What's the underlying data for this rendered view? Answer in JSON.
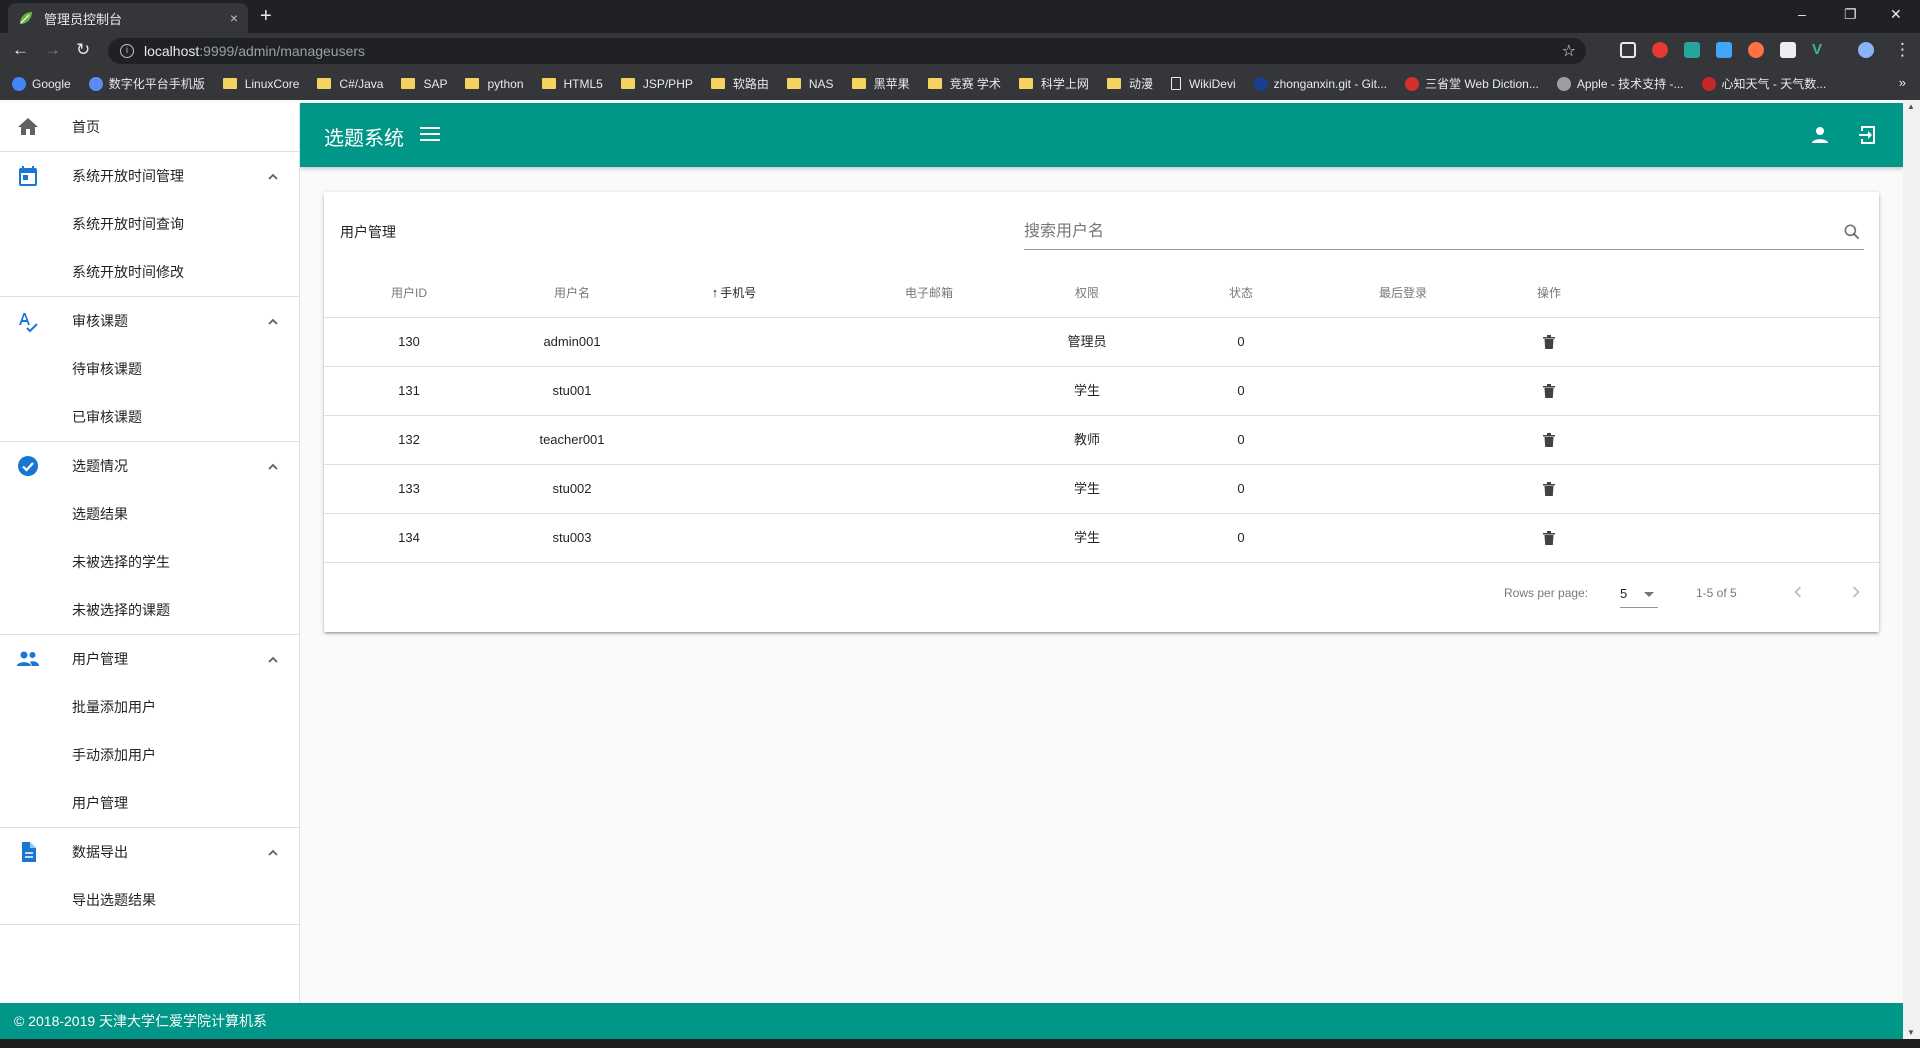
{
  "browser": {
    "tab_title": "管理员控制台",
    "tab_close": "×",
    "new_tab": "+",
    "url_host": "localhost",
    "url_path": ":9999/admin/manageusers",
    "bookmarks": [
      {
        "label": "Google",
        "kind": "dot",
        "color": "#4285f4"
      },
      {
        "label": "数字化平台手机版",
        "kind": "dot",
        "color": "#5b8def"
      },
      {
        "label": "LinuxCore",
        "kind": "folder"
      },
      {
        "label": "C#/Java",
        "kind": "folder"
      },
      {
        "label": "SAP",
        "kind": "folder"
      },
      {
        "label": "python",
        "kind": "folder"
      },
      {
        "label": "HTML5",
        "kind": "folder"
      },
      {
        "label": "JSP/PHP",
        "kind": "folder"
      },
      {
        "label": "软路由",
        "kind": "folder"
      },
      {
        "label": "NAS",
        "kind": "folder"
      },
      {
        "label": "黑苹果",
        "kind": "folder"
      },
      {
        "label": "竞赛 学术",
        "kind": "folder"
      },
      {
        "label": "科学上网",
        "kind": "folder"
      },
      {
        "label": "动漫",
        "kind": "folder"
      },
      {
        "label": "WikiDevi",
        "kind": "page"
      },
      {
        "label": "zhonganxin.git - Git...",
        "kind": "dot",
        "color": "#1a3f8f"
      },
      {
        "label": "三省堂 Web Diction...",
        "kind": "dot",
        "color": "#d32f2f"
      },
      {
        "label": "Apple - 技术支持 -...",
        "kind": "dot",
        "color": "#9e9e9e"
      },
      {
        "label": "心知天气 - 天气数...",
        "kind": "dot",
        "color": "#c62828"
      }
    ],
    "bookmarks_more": "»"
  },
  "app": {
    "title": "选题系统",
    "footer": "© 2018-2019 天津大学仁爱学院计算机系",
    "accent": "#009688",
    "icon_blue": "#1976d2"
  },
  "sidebar": {
    "home": "首页",
    "groups": [
      {
        "label": "系统开放时间管理",
        "icon": "calendar-icon",
        "items": [
          "系统开放时间查询",
          "系统开放时间修改"
        ]
      },
      {
        "label": "审核课题",
        "icon": "spellcheck-icon",
        "items": [
          "待审核课题",
          "已审核课题"
        ]
      },
      {
        "label": "选题情况",
        "icon": "check-circle-icon",
        "items": [
          "选题结果",
          "未被选择的学生",
          "未被选择的课题"
        ]
      },
      {
        "label": "用户管理",
        "icon": "people-icon",
        "items": [
          "批量添加用户",
          "手动添加用户",
          "用户管理"
        ]
      },
      {
        "label": "数据导出",
        "icon": "file-icon",
        "items": [
          "导出选题结果"
        ]
      }
    ]
  },
  "users_card": {
    "title": "用户管理",
    "search_placeholder": "搜索用户名",
    "headers": [
      "用户ID",
      "用户名",
      "手机号",
      "电子邮箱",
      "权限",
      "状态",
      "最后登录",
      "操作"
    ],
    "sorted_arrow": "↑",
    "rows": [
      {
        "id": "130",
        "username": "admin001",
        "phone": "",
        "email": "",
        "role": "管理员",
        "status": "0",
        "last_login": ""
      },
      {
        "id": "131",
        "username": "stu001",
        "phone": "",
        "email": "",
        "role": "学生",
        "status": "0",
        "last_login": ""
      },
      {
        "id": "132",
        "username": "teacher001",
        "phone": "",
        "email": "",
        "role": "教师",
        "status": "0",
        "last_login": ""
      },
      {
        "id": "133",
        "username": "stu002",
        "phone": "",
        "email": "",
        "role": "学生",
        "status": "0",
        "last_login": ""
      },
      {
        "id": "134",
        "username": "stu003",
        "phone": "",
        "email": "",
        "role": "学生",
        "status": "0",
        "last_login": ""
      }
    ],
    "pagination": {
      "rows_per_page_label": "Rows per page:",
      "rows_per_page": "5",
      "range": "1-5 of 5"
    }
  }
}
